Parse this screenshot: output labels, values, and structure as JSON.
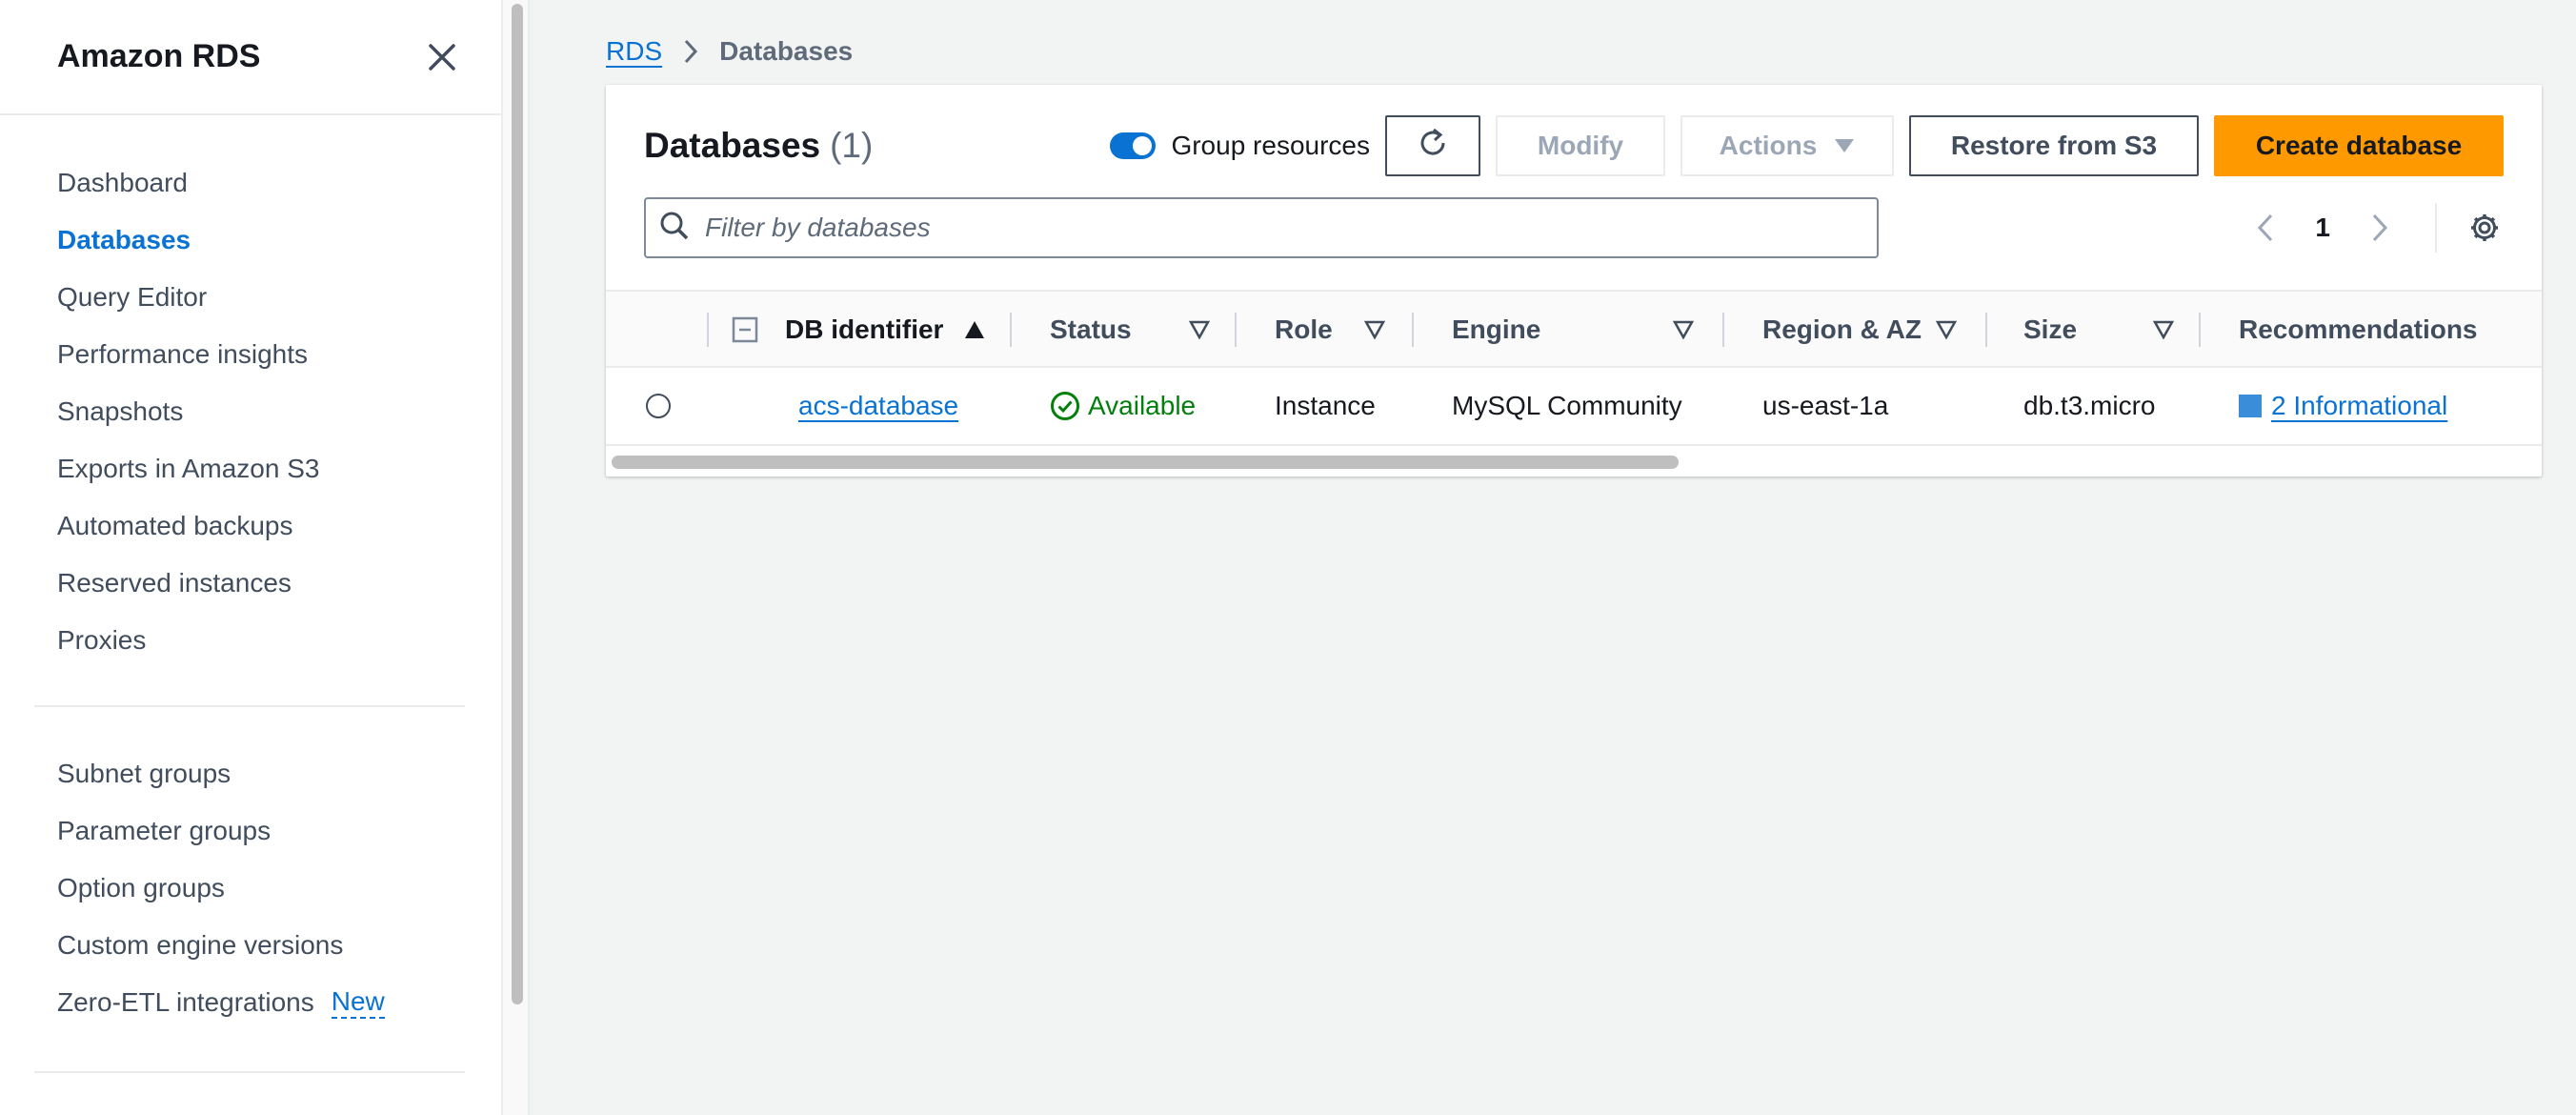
{
  "sidebar": {
    "title": "Amazon RDS",
    "items": [
      {
        "label": "Dashboard"
      },
      {
        "label": "Databases"
      },
      {
        "label": "Query Editor"
      },
      {
        "label": "Performance insights"
      },
      {
        "label": "Snapshots"
      },
      {
        "label": "Exports in Amazon S3"
      },
      {
        "label": "Automated backups"
      },
      {
        "label": "Reserved instances"
      },
      {
        "label": "Proxies"
      }
    ],
    "items2": [
      {
        "label": "Subnet groups"
      },
      {
        "label": "Parameter groups"
      },
      {
        "label": "Option groups"
      },
      {
        "label": "Custom engine versions"
      },
      {
        "label": "Zero-ETL integrations",
        "badge": "New"
      }
    ],
    "active_item": "Databases"
  },
  "breadcrumb": {
    "root": "RDS",
    "current": "Databases"
  },
  "header": {
    "title": "Databases",
    "count": "(1)",
    "group_toggle_label": "Group resources",
    "group_toggle_on": true,
    "modify_label": "Modify",
    "actions_label": "Actions",
    "restore_label": "Restore from S3",
    "create_label": "Create database"
  },
  "filter": {
    "placeholder": "Filter by databases",
    "value": ""
  },
  "pagination": {
    "current_page": "1"
  },
  "table": {
    "columns": {
      "db_identifier": "DB identifier",
      "status": "Status",
      "role": "Role",
      "engine": "Engine",
      "region": "Region & AZ",
      "size": "Size",
      "recommendations": "Recommendations"
    },
    "rows": [
      {
        "db_identifier": "acs-database",
        "status": "Available",
        "role": "Instance",
        "engine": "MySQL Community",
        "region": "us-east-1a",
        "size": "db.t3.micro",
        "recommendations": "2 Informational"
      }
    ]
  },
  "colors": {
    "primary": "#ff9900",
    "link": "#0972d3",
    "success": "#037f0c"
  },
  "icons": [
    "close-icon",
    "chevron-right-icon",
    "refresh-icon",
    "caret-down-icon",
    "search-icon",
    "chevron-left-icon",
    "gear-icon",
    "sort-ascending-icon",
    "sort-icon",
    "check-circle-icon",
    "info-square-icon"
  ]
}
